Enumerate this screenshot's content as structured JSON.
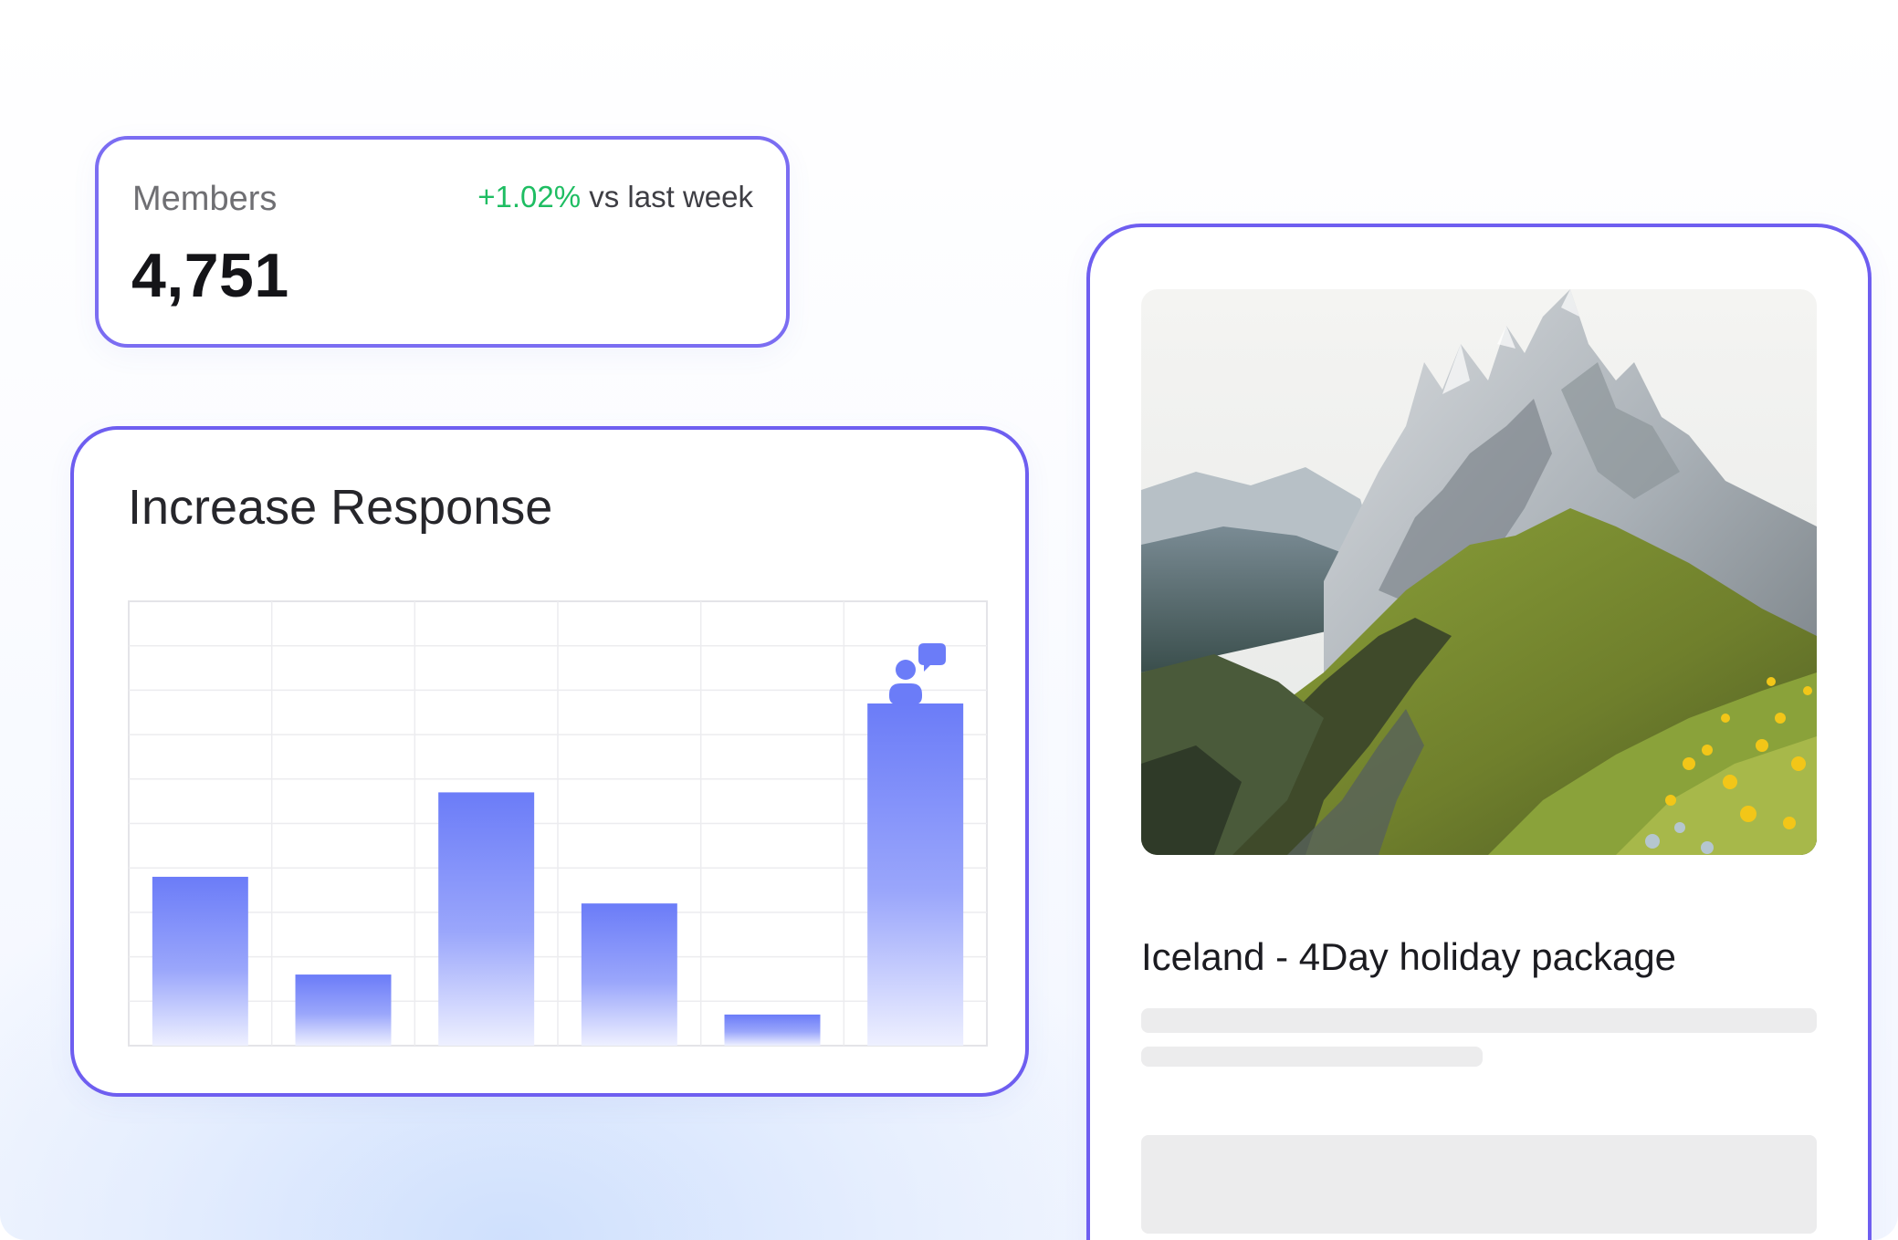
{
  "members": {
    "label": "Members",
    "value": "4,751",
    "delta": "+1.02%",
    "delta_suffix": " vs last week",
    "delta_color": "#1ebd62"
  },
  "response_chart": {
    "title": "Increase Response",
    "icon": "users-chat-icon",
    "accent_color": "#6b7cf8",
    "border_color": "#6e5ef0"
  },
  "chart_data": {
    "type": "bar",
    "title": "Increase Response",
    "xlabel": "",
    "ylabel": "",
    "ylim": [
      0,
      10
    ],
    "grid": true,
    "values": [
      3.8,
      1.6,
      5.7,
      3.2,
      0.7,
      7.7
    ]
  },
  "travel_card": {
    "title": "Iceland - 4Day holiday package",
    "image_alt": "mountain-landscape"
  }
}
